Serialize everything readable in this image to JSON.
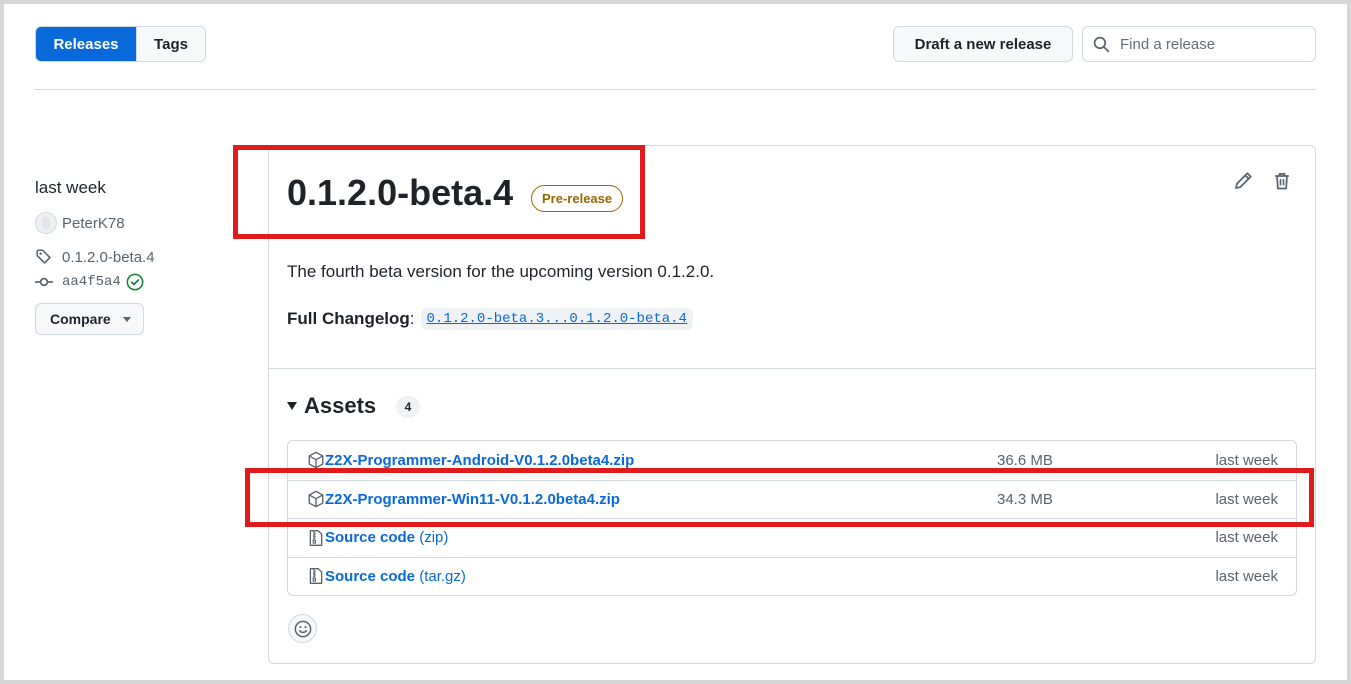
{
  "tabs": [
    {
      "label": "Releases",
      "active": true
    },
    {
      "label": "Tags",
      "active": false
    }
  ],
  "toolbar": {
    "draft_label": "Draft a new release",
    "search_placeholder": "Find a release"
  },
  "sidebar": {
    "date": "last week",
    "author": "PeterK78",
    "tag": "0.1.2.0-beta.4",
    "commit": "aa4f5a4",
    "compare_label": "Compare"
  },
  "release": {
    "title": "0.1.2.0-beta.4",
    "badge": "Pre-release",
    "description": "The fourth beta version for the upcoming version 0.1.2.0.",
    "changelog_label": "Full Changelog",
    "changelog_link": "0.1.2.0-beta.3...0.1.2.0-beta.4"
  },
  "assets": {
    "title": "Assets",
    "count": "4",
    "items": [
      {
        "name": "Z2X-Programmer-Android-V0.1.2.0beta4.zip",
        "ext": "",
        "size": "36.6 MB",
        "date": "last week",
        "icon": "package-icon"
      },
      {
        "name": "Z2X-Programmer-Win11-V0.1.2.0beta4.zip",
        "ext": "",
        "size": "34.3 MB",
        "date": "last week",
        "icon": "package-icon"
      },
      {
        "name": "Source code",
        "ext": "(zip)",
        "size": "",
        "date": "last week",
        "icon": "file-zip-icon"
      },
      {
        "name": "Source code",
        "ext": "(tar.gz)",
        "size": "",
        "date": "last week",
        "icon": "file-zip-icon"
      }
    ]
  },
  "colors": {
    "accent": "#0969da",
    "prerelease": "#9a6700",
    "highlight": "#e01b1b",
    "verified": "#1a7f37"
  }
}
